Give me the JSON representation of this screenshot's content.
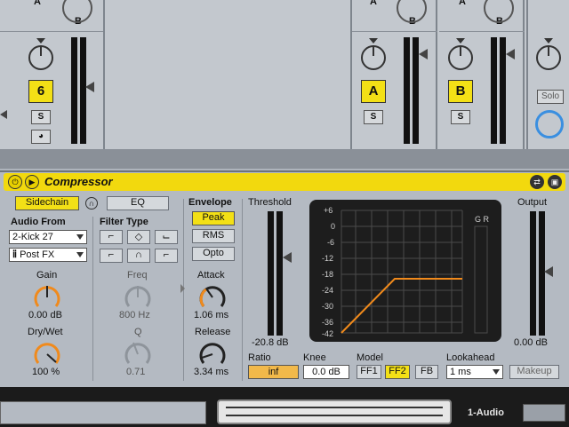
{
  "mixer": {
    "strip_track_labels": [
      "6",
      "A",
      "B"
    ],
    "solo_label": "S",
    "solo_button_label": "Solo",
    "knob_labels": [
      "A",
      "B"
    ]
  },
  "device": {
    "title": "Compressor",
    "sidechain_label": "Sidechain",
    "eq_label": "EQ",
    "audio_from_label": "Audio From",
    "audio_from_value": "2-Kick 27",
    "audio_from_tap": "Post FX",
    "filter_type_label": "Filter Type",
    "gain_label": "Gain",
    "gain_value": "0.00 dB",
    "drywet_label": "Dry/Wet",
    "drywet_value": "100 %",
    "freq_label": "Freq",
    "freq_value": "800 Hz",
    "q_label": "Q",
    "q_value": "0.71",
    "envelope_label": "Envelope",
    "envelope_options": [
      "Peak",
      "RMS",
      "Opto"
    ],
    "envelope_selected": "Peak",
    "attack_label": "Attack",
    "attack_value": "1.06 ms",
    "release_label": "Release",
    "release_value": "3.34 ms",
    "threshold_label": "Threshold",
    "threshold_value": "-20.8 dB",
    "output_label": "Output",
    "output_value": "0.00 dB",
    "gr_label": "G R",
    "ratio_label": "Ratio",
    "ratio_value": "inf",
    "knee_label": "Knee",
    "knee_value": "0.0 dB",
    "model_label": "Model",
    "model_options": [
      "FF1",
      "FF2",
      "FB"
    ],
    "model_selected": "FF2",
    "lookahead_label": "Lookahead",
    "lookahead_value": "1 ms",
    "makeup_label": "Makeup",
    "graph_ticks": [
      "+6",
      "0",
      "-6",
      "-12",
      "-18",
      "-24",
      "-30",
      "-36",
      "-42"
    ]
  },
  "bottom": {
    "track_name": "1-Audio"
  },
  "colors": {
    "accent": "#f3e016",
    "curve": "#f08a1c",
    "panel": "#b4bac2"
  }
}
